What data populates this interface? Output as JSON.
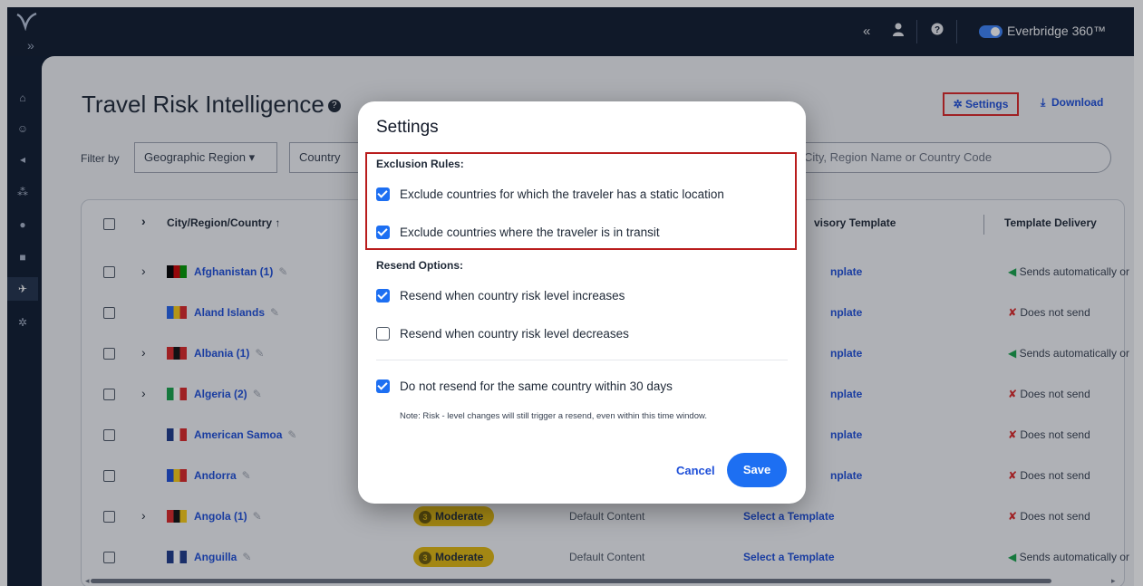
{
  "topbar": {
    "collapse_glyph": "«",
    "user_icon": "user-icon",
    "help_icon": "help-icon",
    "brand": "Everbridge 360™"
  },
  "sidebar": {
    "items": [
      "home-icon",
      "people-icon",
      "megaphone-icon",
      "network-icon",
      "location-icon",
      "dashboard-icon",
      "plane-icon",
      "gear-icon"
    ],
    "active": "plane-icon"
  },
  "page": {
    "title": "Travel Risk Intelligence",
    "settings_label": "Settings",
    "download_label": "Download",
    "filter_label": "Filter by",
    "filter_region": "Geographic Region",
    "filter_country": "Country",
    "search_placeholder": "City, Region Name or Country Code"
  },
  "table": {
    "headers": {
      "name": "City/Region/Country",
      "advisory": "visory Template",
      "delivery": "Template Delivery"
    },
    "rows": [
      {
        "name": "Afghanistan (1)",
        "expandable": true,
        "tpl": "nplate",
        "delivery": "Sends automatically or",
        "sends": true
      },
      {
        "name": "Aland Islands",
        "expandable": false,
        "tpl": "nplate",
        "delivery": "Does not send",
        "sends": false
      },
      {
        "name": "Albania (1)",
        "expandable": true,
        "tpl": "nplate",
        "delivery": "Sends automatically or",
        "sends": true
      },
      {
        "name": "Algeria (2)",
        "expandable": true,
        "tpl": "nplate",
        "delivery": "Does not send",
        "sends": false
      },
      {
        "name": "American Samoa",
        "expandable": false,
        "tpl": "nplate",
        "delivery": "Does not send",
        "sends": false
      },
      {
        "name": "Andorra",
        "expandable": false,
        "tpl": "nplate",
        "delivery": "Does not send",
        "sends": false
      },
      {
        "name": "Angola (1)",
        "expandable": true,
        "risk": "Moderate",
        "content": "Default Content",
        "tpl": "Select a Template",
        "delivery": "Does not send",
        "sends": false
      },
      {
        "name": "Anguilla",
        "expandable": false,
        "risk": "Moderate",
        "content": "Default Content",
        "tpl": "Select a Template",
        "delivery": "Sends automatically or",
        "sends": true
      }
    ]
  },
  "modal": {
    "title": "Settings",
    "exclusion_title": "Exclusion Rules:",
    "exclusion": [
      {
        "label": "Exclude countries for which the traveler has a static location",
        "checked": true
      },
      {
        "label": "Exclude countries where the traveler is in transit",
        "checked": true
      }
    ],
    "resend_title": "Resend Options:",
    "resend": [
      {
        "label": "Resend when country risk level increases",
        "checked": true
      },
      {
        "label": "Resend when country risk level decreases",
        "checked": false
      }
    ],
    "no_resend": {
      "label": "Do not resend for the same country within 30 days",
      "checked": true
    },
    "note": "Note: Risk - level changes will still trigger a resend, even within this time window.",
    "cancel": "Cancel",
    "save": "Save"
  },
  "colors": {
    "accent": "#1d6ff2",
    "highlight_border": "#dc2626",
    "moderate": "#e1b80d"
  }
}
